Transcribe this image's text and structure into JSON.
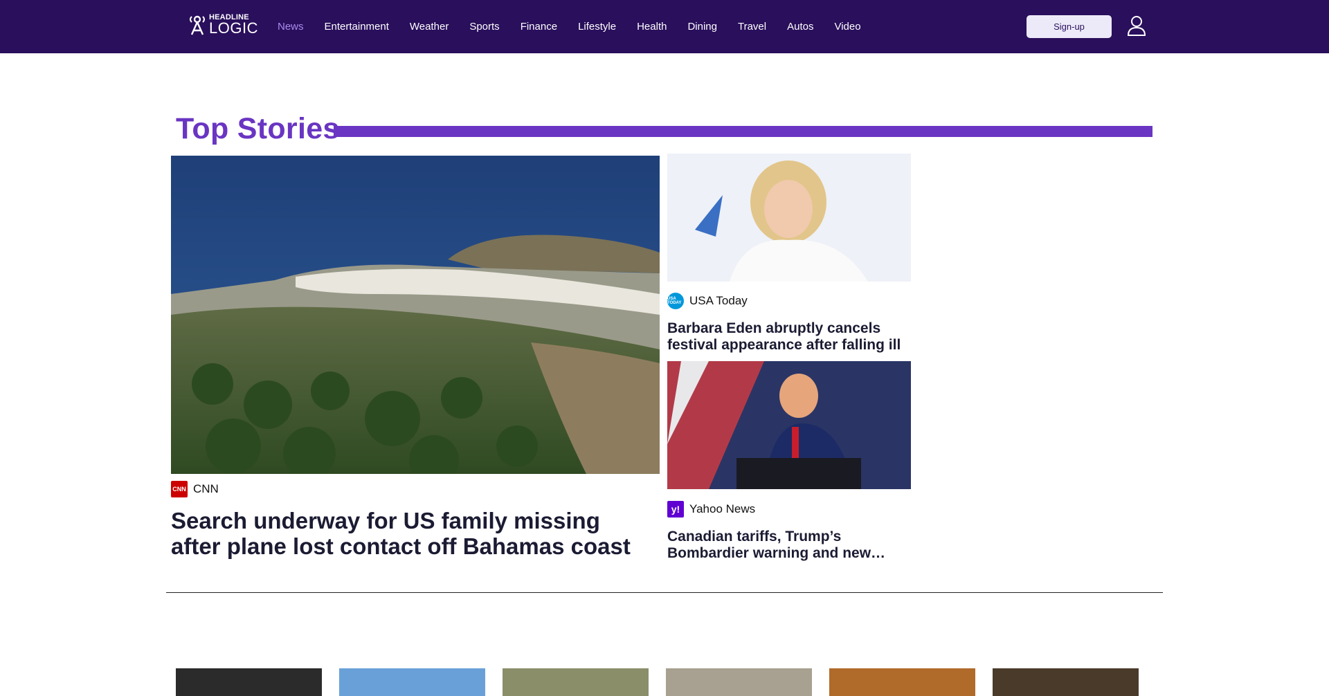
{
  "header": {
    "logo": {
      "line1": "HEADLINE",
      "line2": "LOGIC"
    },
    "nav": [
      {
        "label": "News",
        "active": true
      },
      {
        "label": "Entertainment",
        "active": false
      },
      {
        "label": "Weather",
        "active": false
      },
      {
        "label": "Sports",
        "active": false
      },
      {
        "label": "Finance",
        "active": false
      },
      {
        "label": "Lifestyle",
        "active": false
      },
      {
        "label": "Health",
        "active": false
      },
      {
        "label": "Dining",
        "active": false
      },
      {
        "label": "Travel",
        "active": false
      },
      {
        "label": "Autos",
        "active": false
      },
      {
        "label": "Video",
        "active": false
      }
    ],
    "signup_label": "Sign-up",
    "user_icon": "user-icon"
  },
  "top_stories": {
    "title": "Top Stories",
    "main": {
      "source": "CNN",
      "source_logo_text": "CNN",
      "headline": "Search underway for US family missing after plane lost contact off Bahamas coast"
    },
    "side": [
      {
        "source": "USA Today",
        "source_logo_text": "USA TODAY",
        "headline": "Barbara Eden abruptly cancels festival appearance after falling ill"
      },
      {
        "source": "Yahoo News",
        "source_logo_text": "y!",
        "headline": "Canadian tariffs, Trump’s Bombardier warning and new…"
      }
    ]
  },
  "colors": {
    "header_bg": "#2a0f5c",
    "accent": "#6a35c2",
    "nav_active": "#a98bec"
  }
}
